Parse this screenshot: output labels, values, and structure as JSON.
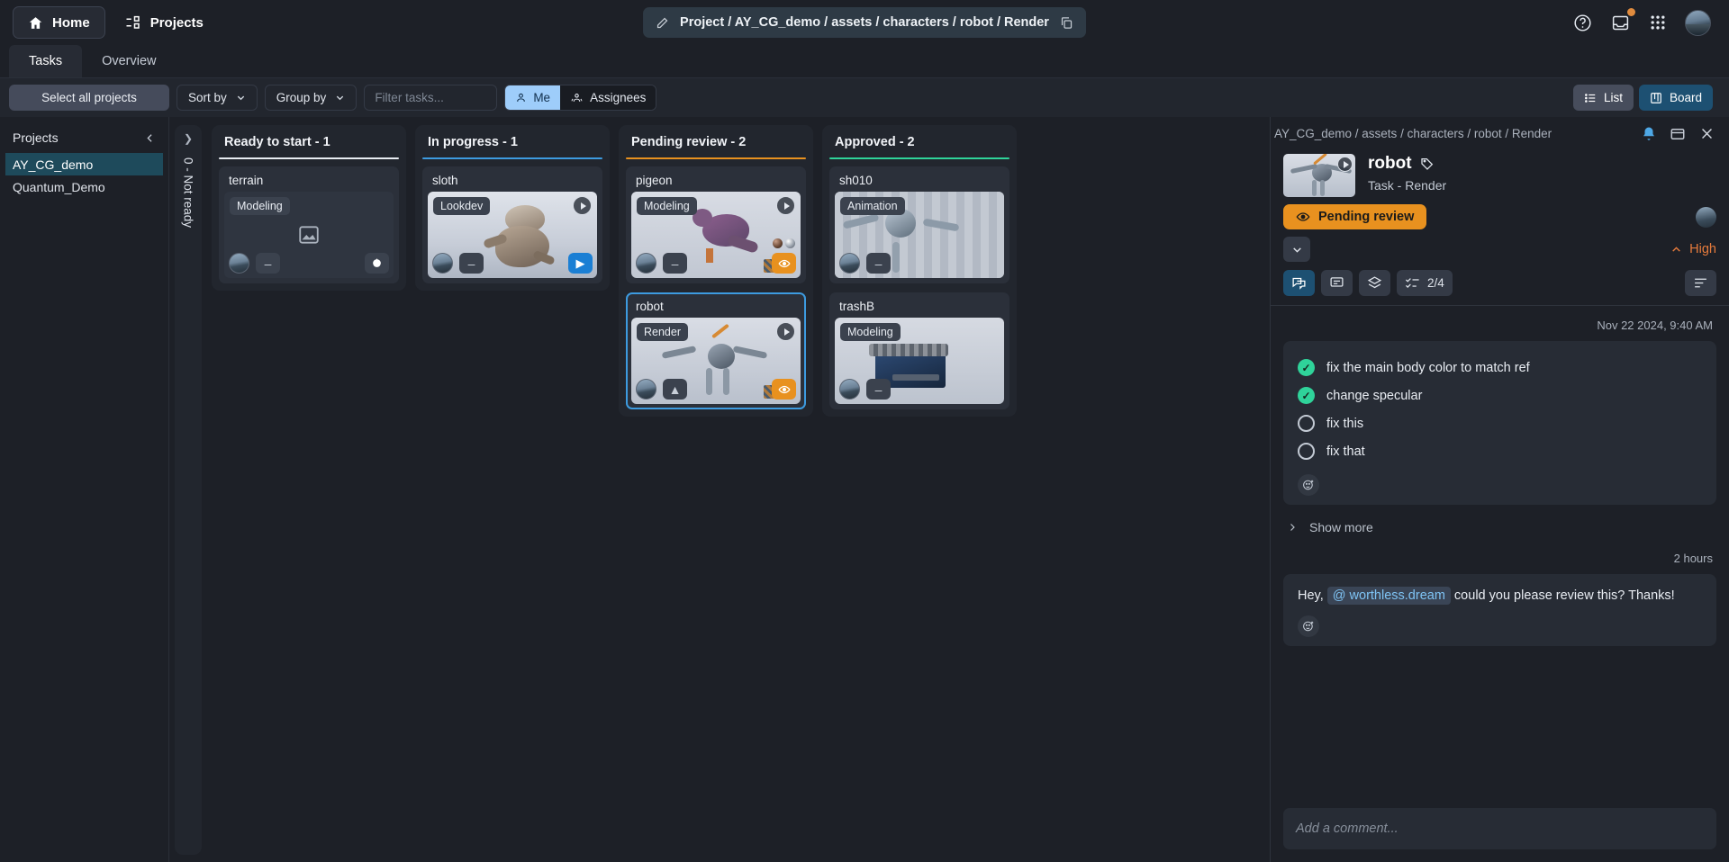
{
  "topbar": {
    "home_label": "Home",
    "projects_label": "Projects",
    "breadcrumb": "Project / AY_CG_demo / assets / characters / robot / Render",
    "icons": [
      "pencil-icon",
      "copy-icon",
      "help-icon",
      "inbox-icon",
      "apps-grid-icon",
      "user-avatar"
    ]
  },
  "tabs": [
    {
      "label": "Tasks",
      "active": true
    },
    {
      "label": "Overview",
      "active": false
    }
  ],
  "toolbar": {
    "select_all_label": "Select all projects",
    "sort_by_label": "Sort by",
    "group_by_label": "Group by",
    "filter_placeholder": "Filter tasks...",
    "me_label": "Me",
    "assignees_label": "Assignees",
    "list_label": "List",
    "board_label": "Board",
    "active_view": "Board"
  },
  "sidebar": {
    "title": "Projects",
    "items": [
      {
        "label": "AY_CG_demo",
        "selected": true
      },
      {
        "label": "Quantum_Demo",
        "selected": false
      }
    ]
  },
  "board": {
    "collapsed_column": "0 - Not ready",
    "columns": [
      {
        "title": "Ready to start - 1",
        "rule_color": "#e8ecf2",
        "cards": [
          {
            "title": "terrain",
            "chip": "Modeling",
            "art": "empty",
            "right_button": "pin",
            "right_color": "grey",
            "selected": false
          }
        ]
      },
      {
        "title": "In progress - 1",
        "rule_color": "#3d9be0",
        "cards": [
          {
            "title": "sloth",
            "chip": "Lookdev",
            "art": "sloth",
            "right_button": "play",
            "right_color": "blue",
            "selected": false
          }
        ]
      },
      {
        "title": "Pending review - 2",
        "rule_color": "#e8911f",
        "cards": [
          {
            "title": "pigeon",
            "chip": "Modeling",
            "art": "pigeon",
            "right_button": "eye",
            "right_color": "orange",
            "selected": false
          },
          {
            "title": "robot",
            "chip": "Render",
            "art": "robot",
            "right_button": "eye",
            "right_color": "orange",
            "selected": true
          }
        ]
      },
      {
        "title": "Approved - 2",
        "rule_color": "#2fd39a",
        "cards": [
          {
            "title": "sh010",
            "chip": "Animation",
            "art": "sh010",
            "right_button": "none",
            "right_color": "grey",
            "selected": false
          },
          {
            "title": "trashB",
            "chip": "Modeling",
            "art": "trash",
            "right_button": "none",
            "right_color": "grey",
            "selected": false
          }
        ]
      }
    ]
  },
  "panel": {
    "breadcrumb": "AY_CG_demo / assets / characters / robot / Render",
    "title": "robot",
    "subtitle": "Task -  Render",
    "status": "Pending review",
    "status_color": "#e8911f",
    "priority": "High",
    "priority_color": "#e77b3c",
    "checklist_count": "2/4",
    "tabs": [
      "comments-icon",
      "notes-icon",
      "layers-icon",
      "checklist-icon",
      "filter-icon"
    ],
    "date": "Nov 22 2024, 9:40 AM",
    "checklist": [
      {
        "text": "fix the main body color to match ref",
        "done": true
      },
      {
        "text": "change specular",
        "done": true
      },
      {
        "text": "fix this",
        "done": false
      },
      {
        "text": "fix that",
        "done": false
      }
    ],
    "show_more": "Show more",
    "message_time": "2 hours",
    "message_prefix": "Hey, ",
    "message_mention": "@ worthless.dream",
    "message_suffix": " could you please review this? Thanks!",
    "composer_placeholder": "Add a comment..."
  }
}
